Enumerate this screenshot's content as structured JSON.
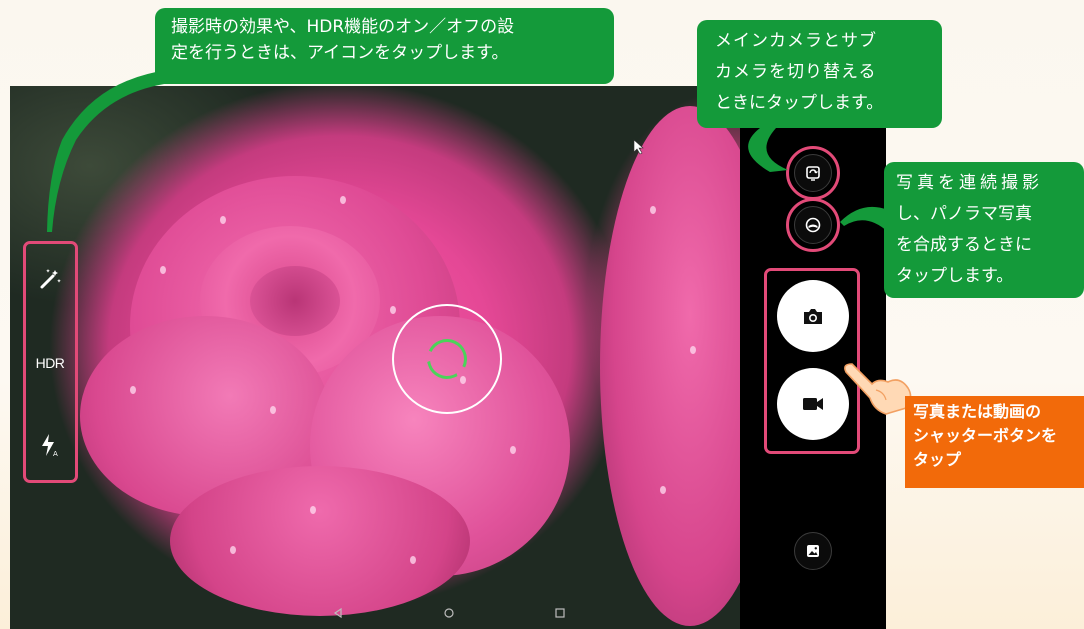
{
  "callouts": {
    "effects": {
      "line1": "撮影時の効果や、HDR機能のオン／オフの設",
      "line2": "定を行うときは、アイコンをタップします。"
    },
    "camera_switch": {
      "line1": "メインカメラとサブ",
      "line2": "カメラを切り替える",
      "line3": "ときにタップします。"
    },
    "panorama": {
      "line1": "写真を連続撮影",
      "line2": "し、パノラマ写真",
      "line3": "を合成するときに",
      "line4": "タップします。"
    },
    "shutter": {
      "line1": "写真または動画の",
      "line2": "シャッターボタンを",
      "line3": "タップ"
    }
  },
  "left_tools": {
    "hdr_label": "HDR"
  },
  "icons": {
    "effects": "magic-wand-icon",
    "hdr": "hdr-icon",
    "flash": "flash-auto-icon",
    "camera_switch": "camera-switch-icon",
    "panorama": "panorama-icon",
    "photo_shutter": "camera-icon",
    "video_shutter": "video-icon",
    "gallery": "gallery-icon",
    "nav_back": "back-icon",
    "nav_home": "home-icon",
    "nav_recents": "recents-icon"
  },
  "colors": {
    "highlight": "#e24a78",
    "callout_green": "#149a3a",
    "callout_orange": "#f26a0a",
    "focus": "#4bd35a"
  }
}
